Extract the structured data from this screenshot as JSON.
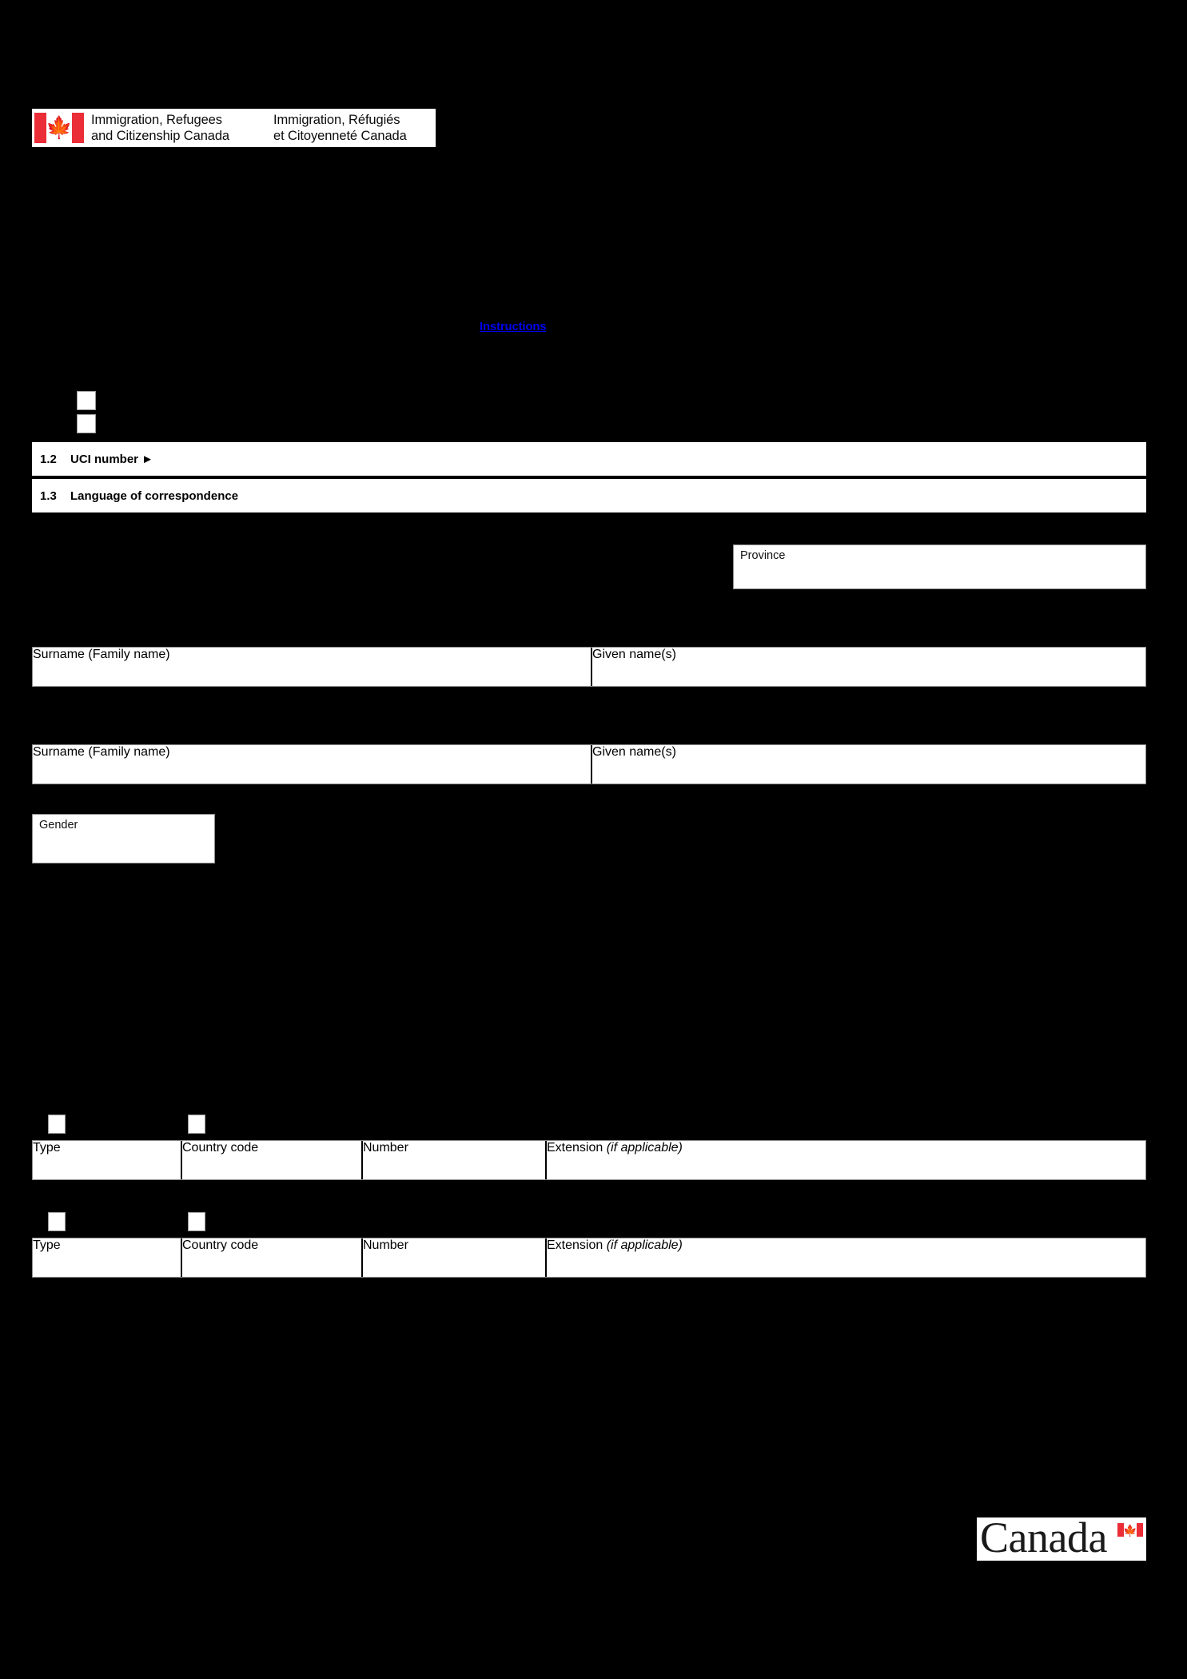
{
  "document": {
    "background_color": "#000000",
    "agency": {
      "name_en": "Immigration, Refugees\nand Citizenship Canada",
      "name_fr": "Immigration, Réfugiés\net Citoyenneté Canada",
      "flag_icon": "canada-flag-icon",
      "maple_leaf": "🍁"
    },
    "instructions_link": {
      "label": "Instructions",
      "color": "#0000EE"
    },
    "language_section": {
      "checkbox_1": "",
      "checkbox_2": ""
    },
    "numbered_rows": [
      {
        "number": "1.2",
        "label": "UCI number ►"
      },
      {
        "number": "1.3",
        "label": "Language of correspondence"
      }
    ],
    "address": {
      "province_label": "Province"
    },
    "applicant_name": {
      "surname_label": "Surname (Family name)",
      "given_label": "Given name(s)"
    },
    "second_name": {
      "surname_label": "Surname (Family name)",
      "given_label": "Given name(s)"
    },
    "gender": {
      "label": "Gender"
    },
    "phone_primary": {
      "type_label": "Type",
      "country_code_label": "Country code",
      "number_label": "Number",
      "extension_label": "Extension ",
      "extension_note": "(if applicable)"
    },
    "phone_alternate": {
      "type_label": "Type",
      "country_code_label": "Country code",
      "number_label": "Number",
      "extension_label": "Extension ",
      "extension_note": "(if applicable)"
    },
    "wordmark": {
      "text": "Canada",
      "flag_icon": "canada-flag-icon"
    }
  }
}
